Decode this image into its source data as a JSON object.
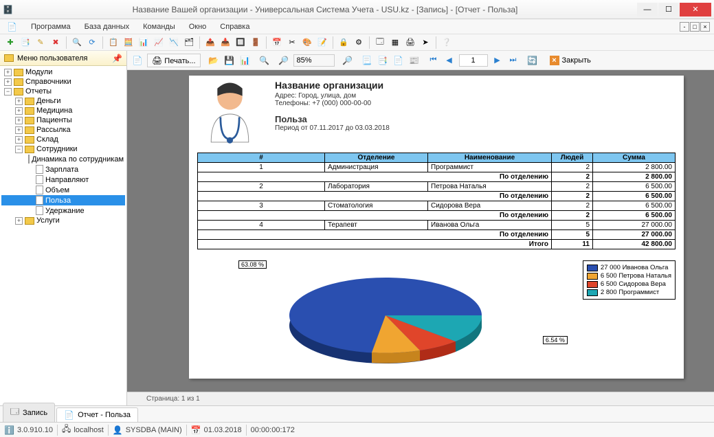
{
  "window": {
    "title": "Название Вашей организации - Универсальная Система Учета - USU.kz - [Запись] - [Отчет - Польза]"
  },
  "menu": {
    "program": "Программа",
    "database": "База данных",
    "commands": "Команды",
    "window": "Окно",
    "help": "Справка"
  },
  "sidebar": {
    "header": "Меню пользователя",
    "modules": "Модули",
    "directories": "Справочники",
    "reports": "Отчеты",
    "money": "Деньги",
    "medicine": "Медицина",
    "patients": "Пациенты",
    "mailing": "Рассылка",
    "warehouse": "Склад",
    "employees": "Сотрудники",
    "dyn": "Динамика по сотрудникам",
    "salary": "Зарплата",
    "referrals": "Направляют",
    "volume": "Объем",
    "benefit": "Польза",
    "deduction": "Удержание",
    "services": "Услуги"
  },
  "reportbar": {
    "print": "Печать...",
    "zoom": "85%",
    "page": "1",
    "close": "Закрыть"
  },
  "report": {
    "org": "Название организации",
    "address": "Адрес: Город, улица, дом",
    "phones": "Телефоны: +7 (000) 000-00-00",
    "title": "Польза",
    "period": "Период от 07.11.2017 до 03.03.2018",
    "cols": {
      "n": "#",
      "dept": "Отделение",
      "name": "Наименование",
      "people": "Людей",
      "sum": "Сумма"
    },
    "subtotal": "По отделению",
    "total": "Итого",
    "rows": [
      {
        "n": "1",
        "dept": "Администрация",
        "name": "Программист",
        "people": "2",
        "sum": "2 800.00",
        "sub_people": "2",
        "sub_sum": "2 800.00"
      },
      {
        "n": "2",
        "dept": "Лаборатория",
        "name": "Петрова Наталья",
        "people": "2",
        "sum": "6 500.00",
        "sub_people": "2",
        "sub_sum": "6 500.00"
      },
      {
        "n": "3",
        "dept": "Стоматология",
        "name": "Сидорова Вера",
        "people": "2",
        "sum": "6 500.00",
        "sub_people": "2",
        "sub_sum": "6 500.00"
      },
      {
        "n": "4",
        "dept": "Терапевт",
        "name": "Иванова Ольга",
        "people": "5",
        "sum": "27 000.00",
        "sub_people": "5",
        "sub_sum": "27 000.00"
      }
    ],
    "total_people": "11",
    "total_sum": "42 800.00"
  },
  "legend": [
    {
      "color": "#2a4fb0",
      "label": "27 000 Иванова Ольга"
    },
    {
      "color": "#f0a531",
      "label": "6 500 Петрова Наталья"
    },
    {
      "color": "#e0452a",
      "label": "6 500 Сидорова Вера"
    },
    {
      "color": "#1da7b3",
      "label": "2 800 Программист"
    }
  ],
  "chart_data": {
    "type": "pie",
    "title": "Польза",
    "categories": [
      "Иванова Ольга",
      "Петрова Наталья",
      "Сидорова Вера",
      "Программист"
    ],
    "values": [
      27000,
      6500,
      6500,
      2800
    ],
    "percent": [
      63.08,
      15.19,
      15.19,
      6.54
    ],
    "colors": [
      "#2a4fb0",
      "#f0a531",
      "#e0452a",
      "#1da7b3"
    ],
    "visible_labels": [
      "63.08 %",
      "6.54 %"
    ]
  },
  "pagestatus": "Страница: 1 из 1",
  "tabs": {
    "record": "Запись",
    "report": "Отчет - Польза"
  },
  "status": {
    "ver": "3.0.910.10",
    "host": "localhost",
    "user": "SYSDBA (MAIN)",
    "date": "01.03.2018",
    "time": "00:00:00:172"
  }
}
